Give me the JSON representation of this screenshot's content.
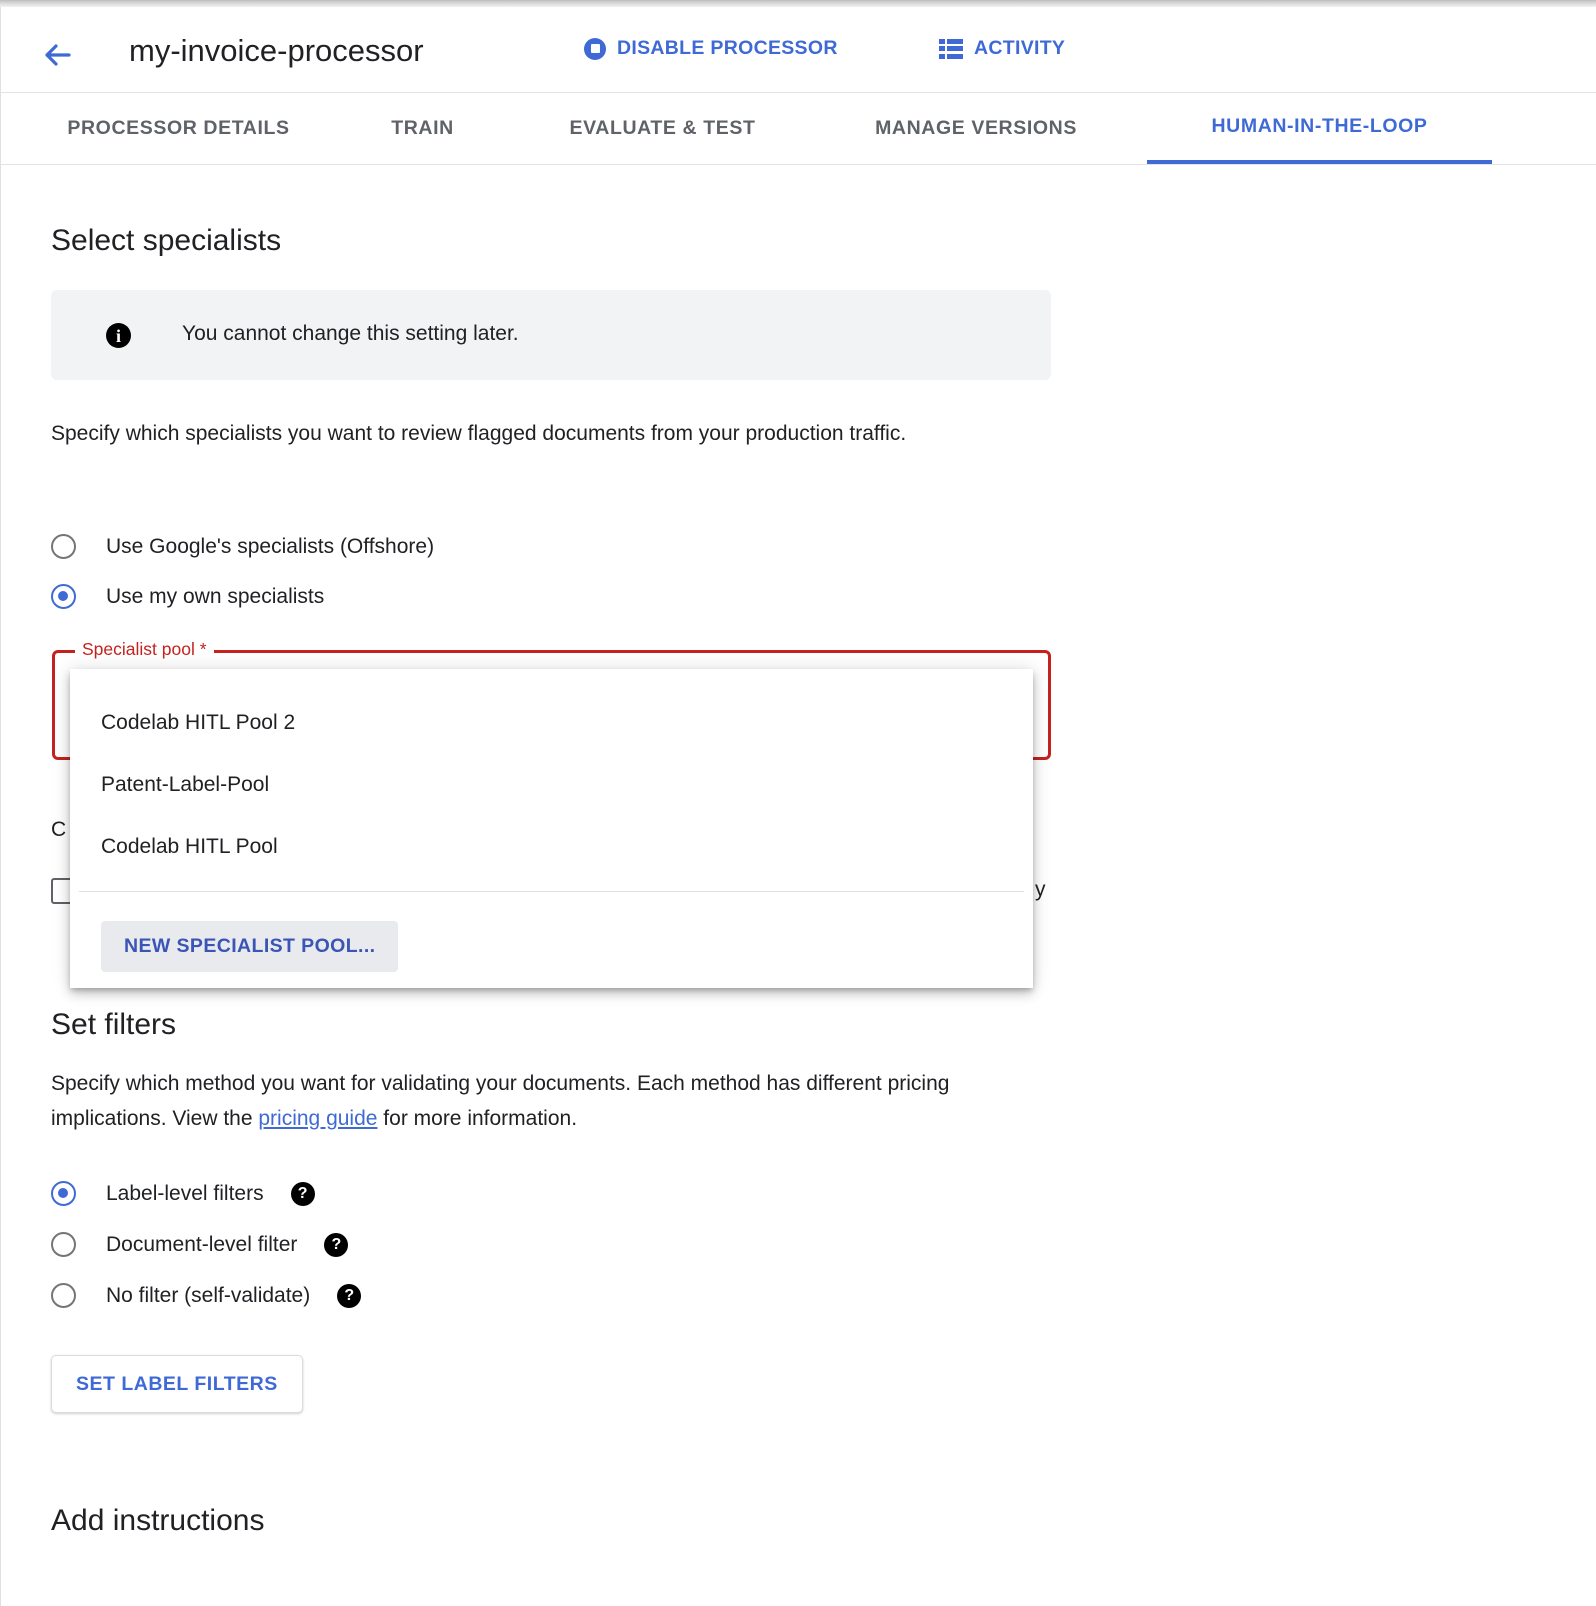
{
  "colors": {
    "accent_blue": "#3f6ad6",
    "error_red": "#c5221f",
    "text_primary": "#202124",
    "text_secondary": "#5f6368",
    "banner_bg": "#f1f3f4"
  },
  "header": {
    "back_icon": "arrow-left-icon",
    "title": "my-invoice-processor",
    "actions": [
      {
        "icon": "stop-circle-icon",
        "label": "DISABLE PROCESSOR"
      },
      {
        "icon": "list-icon",
        "label": "ACTIVITY"
      }
    ]
  },
  "tabs": [
    {
      "label": "PROCESSOR DETAILS",
      "active": false
    },
    {
      "label": "TRAIN",
      "active": false
    },
    {
      "label": "EVALUATE & TEST",
      "active": false
    },
    {
      "label": "MANAGE VERSIONS",
      "active": false
    },
    {
      "label": "HUMAN-IN-THE-LOOP",
      "active": true
    }
  ],
  "select_specialists": {
    "title": "Select specialists",
    "banner": {
      "icon": "info-icon",
      "glyph": "i",
      "text": "You cannot change this setting later."
    },
    "description": "Specify which specialists you want to review flagged documents from your production traffic.",
    "options": [
      {
        "label": "Use Google's specialists (Offshore)",
        "selected": false
      },
      {
        "label": "Use my own specialists",
        "selected": true
      }
    ],
    "pool_field": {
      "legend": "Specialist pool *",
      "value": ""
    },
    "obscured_row": {
      "prefix": "C",
      "suffix": "y"
    }
  },
  "dropdown": {
    "options": [
      "Codelab HITL Pool 2",
      "Patent-Label-Pool",
      "Codelab HITL Pool"
    ],
    "new_pool_label": "NEW SPECIALIST POOL..."
  },
  "set_filters": {
    "title": "Set filters",
    "description_part1": "Specify which method you want for validating your documents. Each method has different pricing implications. View the ",
    "link_text": "pricing guide",
    "description_part2": " for more information.",
    "options": [
      {
        "label": "Label-level filters",
        "selected": true,
        "help": "?"
      },
      {
        "label": "Document-level filter",
        "selected": false,
        "help": "?"
      },
      {
        "label": "No filter (self-validate)",
        "selected": false,
        "help": "?"
      }
    ],
    "button_label": "SET LABEL FILTERS"
  },
  "add_instructions": {
    "title": "Add instructions"
  }
}
